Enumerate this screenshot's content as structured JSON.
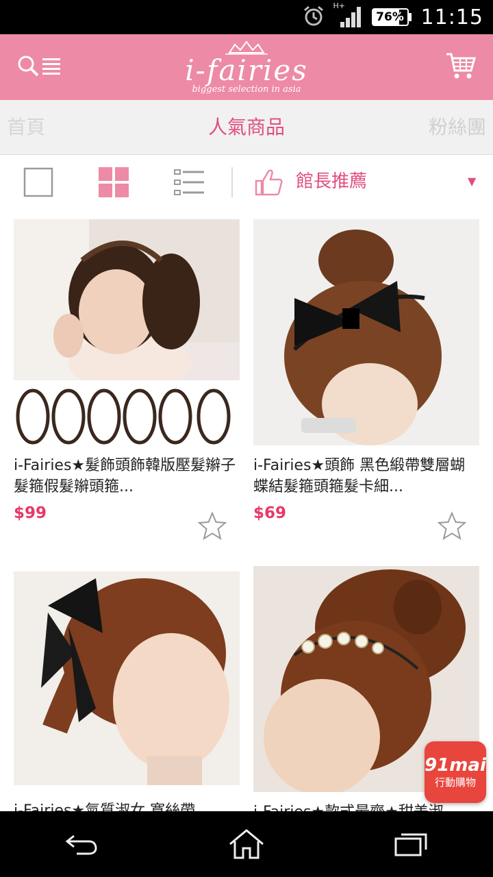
{
  "status_bar": {
    "network": "H+",
    "battery": "76%",
    "battery_level": 0.76,
    "time": "11:15"
  },
  "header": {
    "logo_text": "i-fairies",
    "logo_tagline": "biggest selection in asia",
    "accent": "#ed8aa5"
  },
  "category_tabs": {
    "left": "首頁",
    "active": "人氣商品",
    "right": "粉絲團",
    "active_color": "#e04e7e"
  },
  "toolbar": {
    "sort_label": "館長推薦",
    "sort_arrow": "▼"
  },
  "products": [
    {
      "title": "i-Fairies★髮飾頭飾韓版壓髮辮子髮箍假髮辮頭箍...",
      "price": "$99"
    },
    {
      "title": "i-Fairies★頭飾 黑色緞帶雙層蝴蝶結髮箍頭箍髮卡細...",
      "price": "$69"
    },
    {
      "title": "i-Fairies★氣質淑女 寬絲帶...",
      "price": ""
    },
    {
      "title": "i-Fairies★款式最齊★甜美淑...",
      "price": ""
    }
  ],
  "badge": {
    "top": "91mai",
    "bottom": "行動購物"
  }
}
